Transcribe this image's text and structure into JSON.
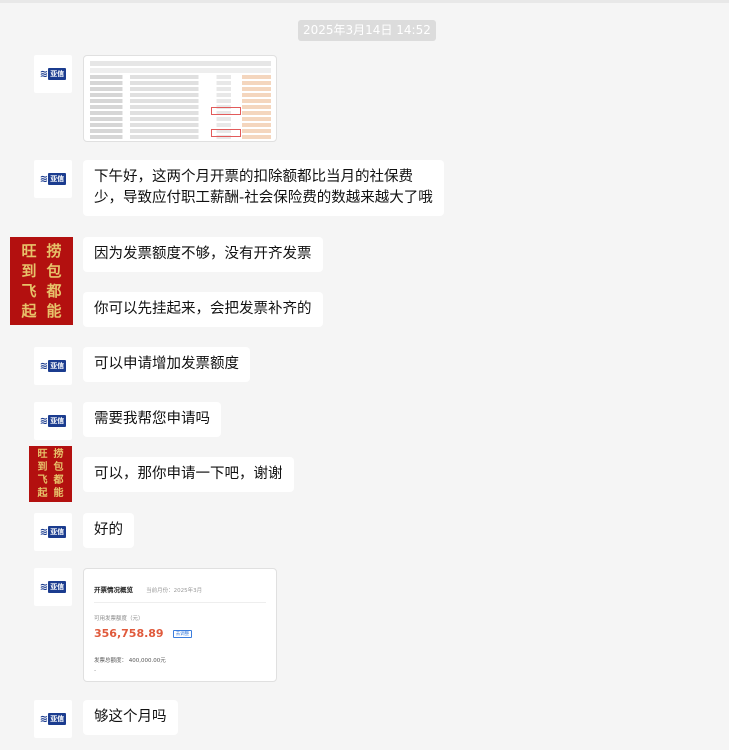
{
  "timestamp": "2025年3月14日 14:52",
  "avatar_logo": {
    "mark": "≋",
    "text": "亚信"
  },
  "avatar_user": {
    "chars": [
      "旺",
      "捞",
      "到",
      "包",
      "飞",
      "都",
      "起",
      "能"
    ]
  },
  "messages": [
    {
      "sender": "agent",
      "type": "image"
    },
    {
      "sender": "agent",
      "type": "text",
      "lines": [
        "下午好，这两个月开票的扣除额都比当月的社保费",
        "少，导致应付职工薪酬-社会保险费的数越来越大了哦"
      ]
    },
    {
      "sender": "user",
      "type": "text",
      "lines": [
        "因为发票额度不够，没有开齐发票"
      ]
    },
    {
      "sender": "user",
      "type": "text",
      "lines": [
        "你可以先挂起来，会把发票补齐的"
      ]
    },
    {
      "sender": "agent",
      "type": "text",
      "lines": [
        "可以申请增加发票额度"
      ]
    },
    {
      "sender": "agent",
      "type": "text",
      "lines": [
        "需要我帮您申请吗"
      ]
    },
    {
      "sender": "user",
      "type": "text",
      "lines": [
        "可以，那你申请一下吧，谢谢"
      ]
    },
    {
      "sender": "agent",
      "type": "text",
      "lines": [
        "好的"
      ]
    },
    {
      "sender": "agent",
      "type": "invoice"
    },
    {
      "sender": "agent",
      "type": "text",
      "lines": [
        "够这个月吗"
      ]
    }
  ],
  "invoice": {
    "title": "开票情况概览",
    "period": "当前月份：2025年3月",
    "available_label": "可用发票额度（元）",
    "available_amount": "356,758.89",
    "apply_button": "去调整",
    "total_label": "发票总额度：  400,000.00元",
    "dash": "-"
  },
  "colors": {
    "background": "#f5f5f5",
    "bubble": "#ffffff",
    "timestamp_bg": "#dcdcdc",
    "logo_blue": "#1b3c8f",
    "user_avatar_red": "#b3100f",
    "amount_red": "#e05a3c"
  }
}
